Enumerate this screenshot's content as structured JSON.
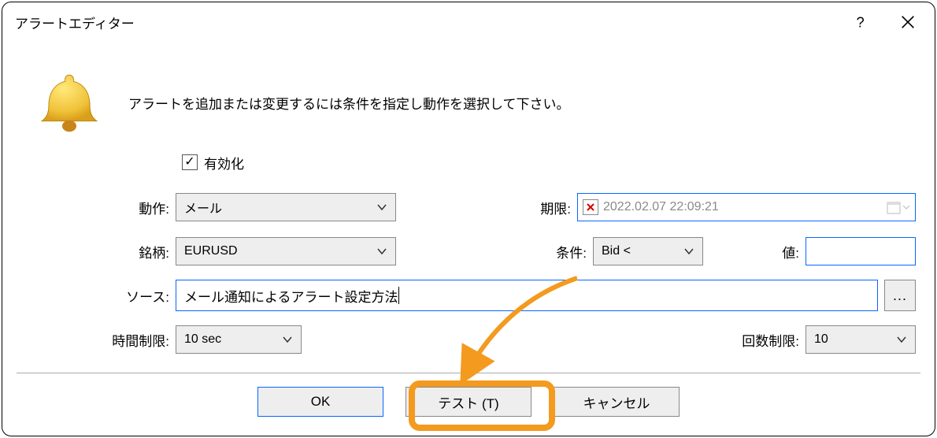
{
  "title": "アラートエディター",
  "instruction": "アラートを追加または変更するには条件を指定し動作を選択して下さい。",
  "enable": {
    "label": "有効化",
    "checked": true
  },
  "labels": {
    "action": "動作:",
    "symbol": "銘柄:",
    "source": "ソース:",
    "timelimit": "時間制限:",
    "deadline": "期限:",
    "condition": "条件:",
    "value": "値:",
    "countlimit": "回数制限:"
  },
  "fields": {
    "action": "メール",
    "symbol": "EURUSD",
    "source": "メール通知によるアラート設定方法",
    "timelimit": "10 sec",
    "deadline": "2022.02.07 22:09:21",
    "condition": "Bid <",
    "value": "",
    "countlimit": "10"
  },
  "buttons": {
    "ok": "OK",
    "test": "テスト (T)",
    "cancel": "キャンセル",
    "more": "..."
  }
}
